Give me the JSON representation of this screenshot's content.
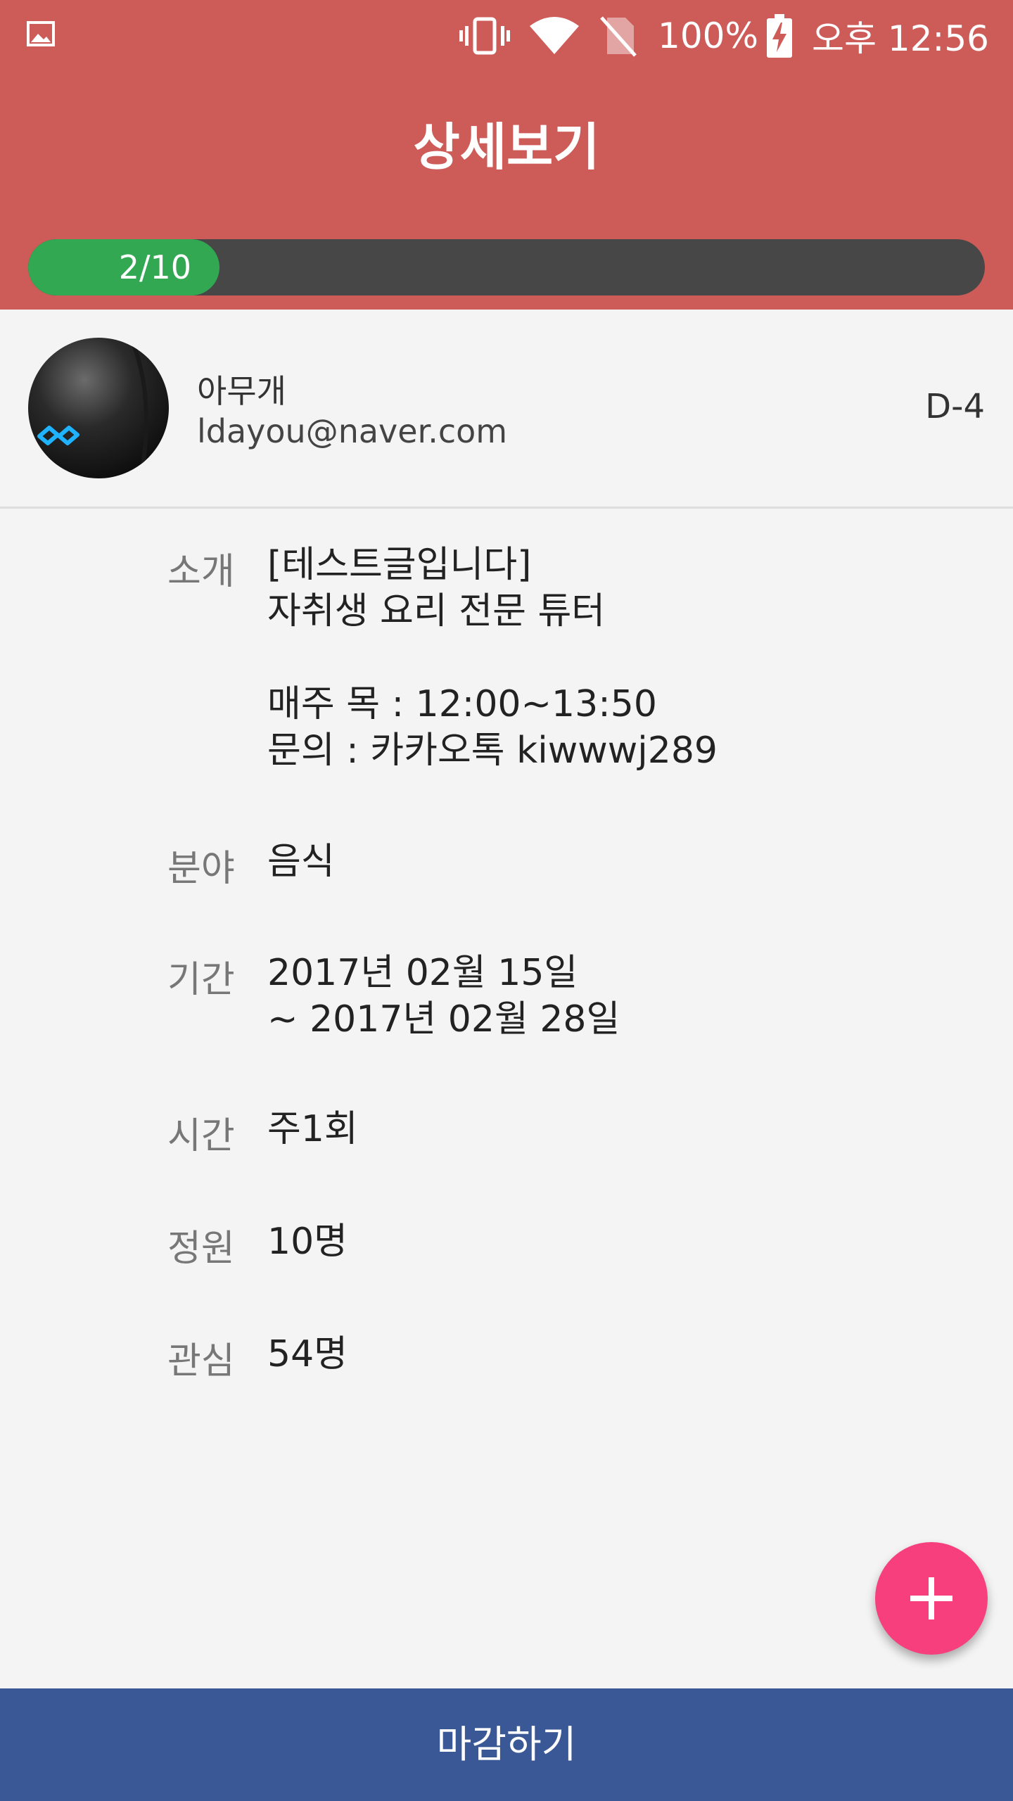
{
  "status_bar": {
    "battery": "100%",
    "time": "오후 12:56",
    "icons": [
      "image-icon",
      "vibrate-icon",
      "wifi-icon",
      "no-sim-icon",
      "battery-charging-icon"
    ]
  },
  "header": {
    "title": "상세보기",
    "progress": {
      "label": "2/10",
      "current": 2,
      "total": 10
    }
  },
  "profile": {
    "name": "아무개",
    "email": "ldayou@naver.com",
    "dday": "D-4"
  },
  "details": {
    "intro_label": "소개",
    "intro_lines": [
      "[테스트글입니다]",
      "자취생 요리 전문 튜터",
      "",
      "매주 목 : 12:00~13:50",
      "문의 : 카카오톡 kiwwwj289"
    ],
    "field_label": "분야",
    "field_value": "음식",
    "period_label": "기간",
    "period_lines": [
      "2017년 02월 15일",
      "~ 2017년 02월 28일"
    ],
    "time_label": "시간",
    "time_value": "주1회",
    "capacity_label": "정원",
    "capacity_value": "10명",
    "interest_label": "관심",
    "interest_value": "54명"
  },
  "fab": {
    "icon": "plus-icon"
  },
  "bottom_button": {
    "label": "마감하기"
  },
  "colors": {
    "header": "#cd5c59",
    "progress_fill": "#32a852",
    "progress_track": "#474747",
    "fab": "#f63f7c",
    "bottom_bar": "#3b5896"
  }
}
